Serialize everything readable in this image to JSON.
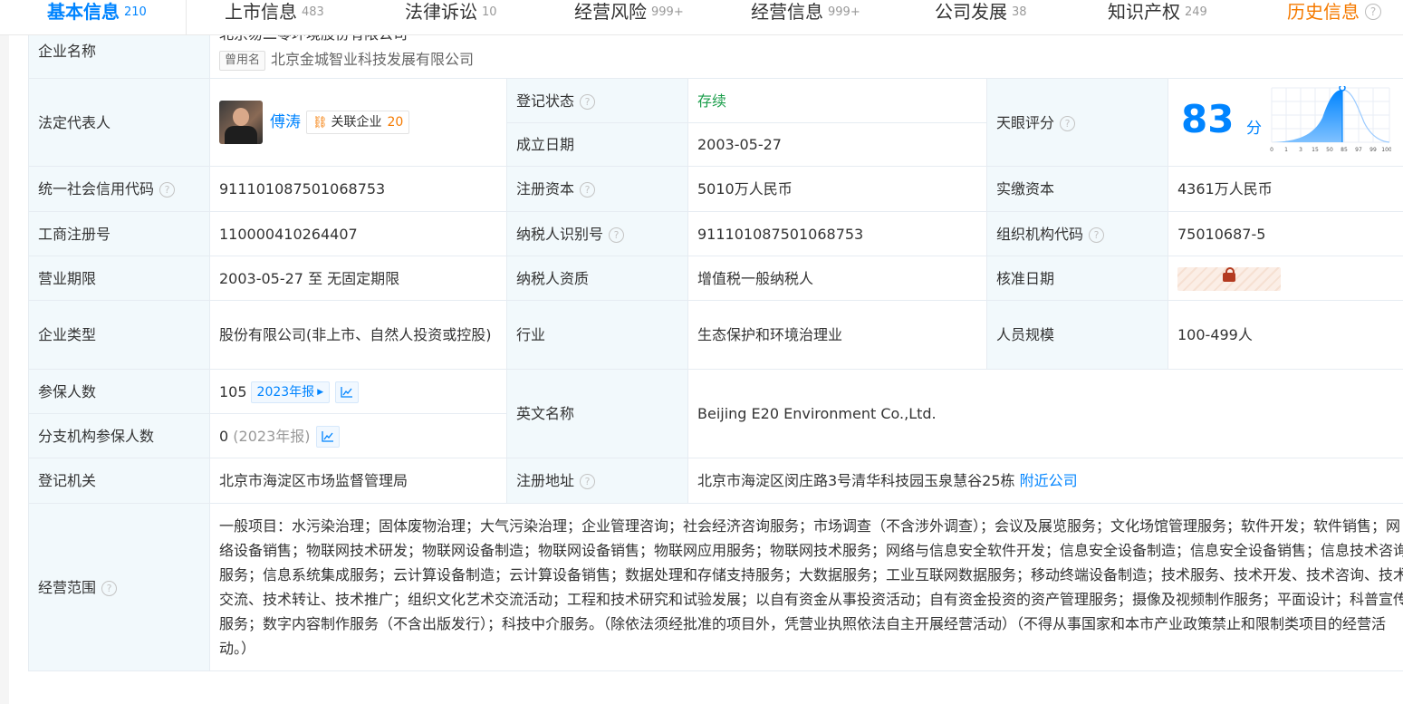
{
  "tabs": [
    {
      "label": "基本信息",
      "count": "210"
    },
    {
      "label": "上市信息",
      "count": "483"
    },
    {
      "label": "法律诉讼",
      "count": "10"
    },
    {
      "label": "经营风险",
      "count": "999+"
    },
    {
      "label": "经营信息",
      "count": "999+"
    },
    {
      "label": "公司发展",
      "count": "38"
    },
    {
      "label": "知识产权",
      "count": "249"
    },
    {
      "label": "历史信息",
      "count": ""
    }
  ],
  "rows": {
    "company_name_label": "企业名称",
    "company_name_cut": "北京易二零环境股份有限公司",
    "former_tag": "曾用名",
    "former_name": "北京金城智业科技发展有限公司",
    "legal_rep_label": "法定代表人",
    "legal_rep_name": "傅涛",
    "related_label": "关联企业",
    "related_count": "20",
    "reg_status_label": "登记状态",
    "reg_status": "存续",
    "found_date_label": "成立日期",
    "found_date": "2003-05-27",
    "tianyan_label": "天眼评分",
    "score": "83",
    "score_unit": "分",
    "score_ticks": [
      "0",
      "1",
      "3",
      "15",
      "50",
      "85",
      "97",
      "99",
      "100"
    ],
    "credit_code_label": "统一社会信用代码",
    "credit_code": "911101087501068753",
    "reg_capital_label": "注册资本",
    "reg_capital": "5010万人民币",
    "paid_capital_label": "实缴资本",
    "paid_capital": "4361万人民币",
    "biz_reg_no_label": "工商注册号",
    "biz_reg_no": "110000410264407",
    "taxpayer_id_label": "纳税人识别号",
    "taxpayer_id": "911101087501068753",
    "org_code_label": "组织机构代码",
    "org_code": "75010687-5",
    "term_label": "营业期限",
    "term": "2003-05-27 至 无固定期限",
    "tax_qual_label": "纳税人资质",
    "tax_qual": "增值税一般纳税人",
    "approve_date_label": "核准日期",
    "type_label": "企业类型",
    "type": "股份有限公司(非上市、自然人投资或控股)",
    "industry_label": "行业",
    "industry": "生态保护和环境治理业",
    "staff_label": "人员规模",
    "staff": "100-499人",
    "insured_label": "参保人数",
    "insured": "105",
    "report_year": "2023年报",
    "branch_insured_label": "分支机构参保人数",
    "branch_insured": "0",
    "branch_year": "(2023年报)",
    "english_label": "英文名称",
    "english": "Beijing E20 Environment Co.,Ltd.",
    "authority_label": "登记机关",
    "authority": "北京市海淀区市场监督管理局",
    "address_label": "注册地址",
    "address": "北京市海淀区闵庄路3号清华科技园玉泉慧谷25栋",
    "nearby": "附近公司",
    "scope_label": "经营范围",
    "scope": "一般项目：水污染治理；固体废物治理；大气污染治理；企业管理咨询；社会经济咨询服务；市场调查（不含涉外调查）；会议及展览服务；文化场馆管理服务；软件开发；软件销售；网络设备销售；物联网技术研发；物联网设备制造；物联网设备销售；物联网应用服务；物联网技术服务；网络与信息安全软件开发；信息安全设备制造；信息安全设备销售；信息技术咨询服务；信息系统集成服务；云计算设备制造；云计算设备销售；数据处理和存储支持服务；大数据服务；工业互联网数据服务；移动终端设备制造；技术服务、技术开发、技术咨询、技术交流、技术转让、技术推广；组织文化艺术交流活动；工程和技术研究和试验发展；以自有资金从事投资活动；自有资金投资的资产管理服务；摄像及视频制作服务；平面设计；科普宣传服务；数字内容制作服务（不含出版发行）；科技中介服务。（除依法须经批准的项目外，凭营业执照依法自主开展经营活动）（不得从事国家和本市产业政策禁止和限制类项目的经营活动。）"
  },
  "colors": {
    "accent": "#0084ff",
    "label_bg": "#f2f9fc",
    "status_green": "#1b9e4b",
    "history_orange": "#f57a00"
  }
}
